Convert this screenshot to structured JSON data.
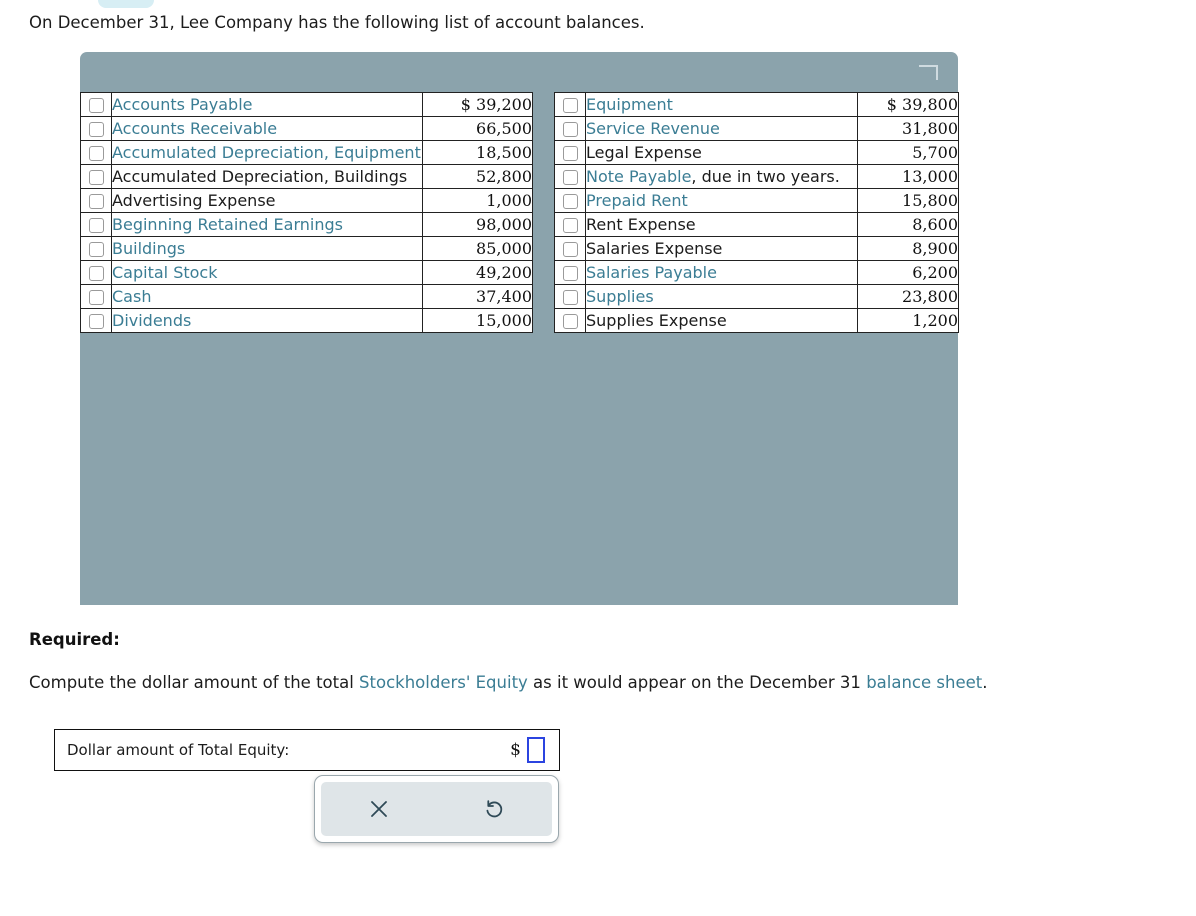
{
  "intro": {
    "text": "On December 31, Lee Company has the following list of account balances."
  },
  "panel": {
    "header_icon": "resize-corner-icon"
  },
  "left_table": {
    "rows": [
      {
        "name": "Accounts Payable",
        "is_link": true,
        "suffix": "",
        "amount": "$ 39,200"
      },
      {
        "name": "Accounts Receivable",
        "is_link": true,
        "suffix": "",
        "amount": "66,500"
      },
      {
        "name": "Accumulated Depreciation, Equipment",
        "is_link": true,
        "suffix": "",
        "amount": "18,500"
      },
      {
        "name": "Accumulated Depreciation, Buildings",
        "is_link": false,
        "suffix": "",
        "amount": "52,800"
      },
      {
        "name": "Advertising Expense",
        "is_link": false,
        "suffix": "",
        "amount": "1,000"
      },
      {
        "name": "Beginning Retained Earnings",
        "is_link": true,
        "suffix": "",
        "amount": "98,000"
      },
      {
        "name": "Buildings",
        "is_link": true,
        "suffix": "",
        "amount": "85,000"
      },
      {
        "name": "Capital Stock",
        "is_link": true,
        "suffix": "",
        "amount": "49,200"
      },
      {
        "name": "Cash",
        "is_link": true,
        "suffix": "",
        "amount": "37,400"
      },
      {
        "name": "Dividends",
        "is_link": true,
        "suffix": "",
        "amount": "15,000"
      }
    ]
  },
  "right_table": {
    "rows": [
      {
        "name": "Equipment",
        "is_link": true,
        "suffix": "",
        "amount": "$ 39,800"
      },
      {
        "name": "Service Revenue",
        "is_link": true,
        "suffix": "",
        "amount": "31,800"
      },
      {
        "name": "Legal Expense",
        "is_link": false,
        "suffix": "",
        "amount": "5,700"
      },
      {
        "name": "Note Payable",
        "is_link": true,
        "suffix": ", due in two years.",
        "amount": "13,000"
      },
      {
        "name": "Prepaid Rent",
        "is_link": true,
        "suffix": "",
        "amount": "15,800"
      },
      {
        "name": "Rent Expense",
        "is_link": false,
        "suffix": "",
        "amount": "8,600"
      },
      {
        "name": "Salaries Expense",
        "is_link": false,
        "suffix": "",
        "amount": "8,900"
      },
      {
        "name": "Salaries Payable",
        "is_link": true,
        "suffix": "",
        "amount": "6,200"
      },
      {
        "name": "Supplies",
        "is_link": true,
        "suffix": "",
        "amount": "23,800"
      },
      {
        "name": "Supplies Expense",
        "is_link": false,
        "suffix": "",
        "amount": "1,200"
      }
    ]
  },
  "required": {
    "label": "Required:",
    "sentence_part1": "Compute the dollar amount of the total ",
    "link1": "Stockholders' Equity",
    "sentence_part2": " as it would appear on the December 31 ",
    "link2": "balance sheet",
    "sentence_part3": "."
  },
  "answer": {
    "label": "Dollar amount of Total Equity:",
    "currency_symbol": "$",
    "value": "",
    "placeholder": ""
  },
  "toolbar": {
    "clear_label": "clear-icon",
    "reset_label": "undo-icon"
  },
  "colors": {
    "panel_header": "#8ba3ac",
    "link": "#3b7d94",
    "input_border": "#2b44e0",
    "toolbar_bg": "#dfe5e8",
    "top_pill": "#d7eef4"
  }
}
